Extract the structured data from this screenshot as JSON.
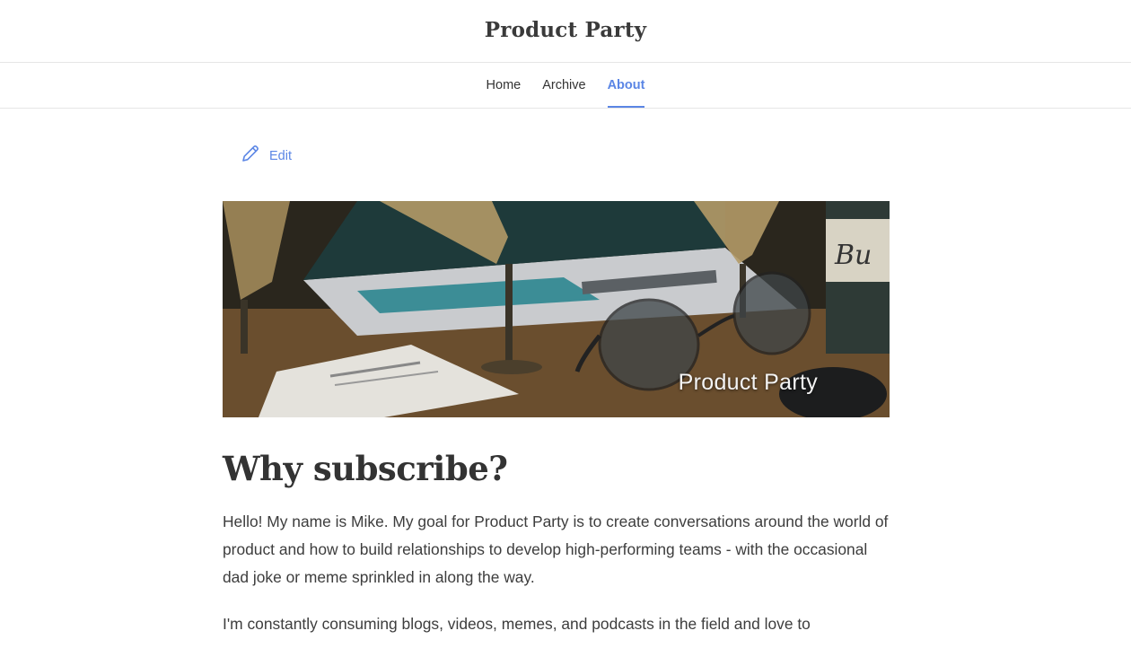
{
  "site": {
    "title": "Product Party"
  },
  "nav": {
    "items": [
      {
        "label": "Home"
      },
      {
        "label": "Archive"
      },
      {
        "label": "About"
      }
    ],
    "active": "About"
  },
  "edit": {
    "label": "Edit",
    "icon": "pencil-icon"
  },
  "hero": {
    "caption": "Product Party"
  },
  "article": {
    "heading": "Why subscribe?",
    "paragraphs": [
      "Hello! My name is Mike. My goal for Product Party is to create conversations around the world of product and how to build relationships to develop high-performing teams - with the occasional dad joke or meme sprinkled in along the way.",
      "I'm constantly consuming blogs, videos, memes, and podcasts in the field and love to"
    ]
  },
  "colors": {
    "accent": "#5b86e5",
    "text": "#333333",
    "divider": "#e6e6e6"
  }
}
